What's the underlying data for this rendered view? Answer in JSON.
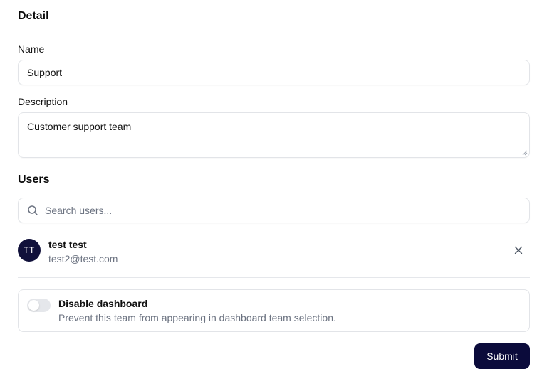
{
  "detail": {
    "title": "Detail",
    "name_label": "Name",
    "name_value": "Support",
    "description_label": "Description",
    "description_value": "Customer support team"
  },
  "users": {
    "title": "Users",
    "search_placeholder": "Search users...",
    "search_icon": "search-icon",
    "list": [
      {
        "initials": "TT",
        "name": "test test",
        "email": "test2@test.com",
        "remove_icon": "close-icon"
      }
    ]
  },
  "settings": {
    "disable_dashboard": {
      "title": "Disable dashboard",
      "description": "Prevent this team from appearing in dashboard team selection.",
      "enabled": false
    }
  },
  "actions": {
    "submit_label": "Submit"
  },
  "colors": {
    "primary": "#0b0b3b",
    "avatar_bg": "#10103a",
    "muted_text": "#6b7280",
    "border": "#e2e4e8"
  }
}
